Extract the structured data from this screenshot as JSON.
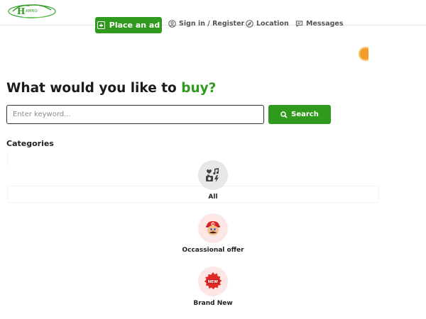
{
  "header": {
    "logo_alt": "HAMRO",
    "place_ad_label": "Place an ad",
    "nav": [
      {
        "label": "Sign in / Register",
        "icon": "user-icon"
      },
      {
        "label": "Location",
        "icon": "compass-icon"
      },
      {
        "label": "Messages",
        "icon": "message-icon"
      }
    ]
  },
  "hero": {
    "title_prefix": "What would you like to ",
    "title_accent": "buy?",
    "search_placeholder": "Enter keyword...",
    "search_button_label": "Search"
  },
  "categories": {
    "title": "Categories",
    "items": [
      {
        "label": "All",
        "icon": "grid-media-icon"
      },
      {
        "label": "Occassional offer",
        "icon": "mario-icon"
      },
      {
        "label": "Brand New",
        "icon": "new-badge-icon"
      }
    ]
  },
  "colors": {
    "accent": "#2f9a1d",
    "circle_gray": "#e7e7e7",
    "circle_pink": "#fde6e6"
  }
}
